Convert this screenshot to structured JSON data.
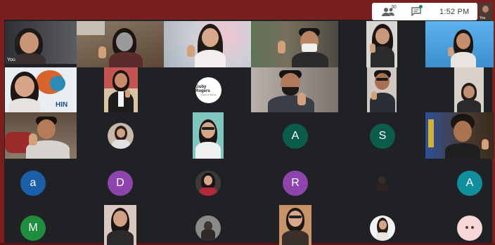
{
  "topbar": {
    "participants_icon": "people-icon",
    "participants_count": "30",
    "chat_icon": "chat-icon",
    "time": "1:52 PM"
  },
  "self_view": {
    "label": "You"
  },
  "tiles": {
    "first_label": "You",
    "logo_text": "Guby Rogers",
    "logo_subtext": "Guest of Honour",
    "banner_text": "HIN"
  },
  "avatars": {
    "row3": [
      "A",
      "S"
    ],
    "row4": [
      "a",
      "D",
      "R",
      "A"
    ],
    "row5": [
      "M"
    ]
  },
  "colors": {
    "frame": "#7a1e1e",
    "grid_bg": "#202124",
    "avatar_teal": "#0b5c4a",
    "avatar_blue": "#1a5fa8",
    "avatar_purple": "#8e44ad",
    "avatar_cyan": "#0f8f9c",
    "avatar_green": "#1e8e3e"
  }
}
